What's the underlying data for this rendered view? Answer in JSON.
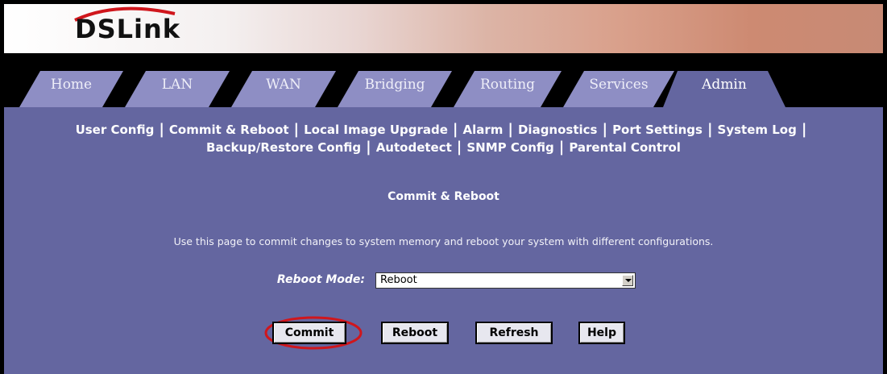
{
  "brand": {
    "logo_text": "DSLink"
  },
  "tabs": [
    {
      "label": "Home",
      "active": false
    },
    {
      "label": "LAN",
      "active": false
    },
    {
      "label": "WAN",
      "active": false
    },
    {
      "label": "Bridging",
      "active": false
    },
    {
      "label": "Routing",
      "active": false
    },
    {
      "label": "Services",
      "active": false
    },
    {
      "label": "Admin",
      "active": true
    }
  ],
  "submenu": {
    "row1": [
      "User Config",
      "Commit & Reboot",
      "Local Image Upgrade",
      "Alarm",
      "Diagnostics",
      "Port Settings",
      "System Log"
    ],
    "row2": [
      "Backup/Restore Config",
      "Autodetect",
      "SNMP Config",
      "Parental Control"
    ],
    "separator": "|"
  },
  "page": {
    "title": "Commit & Reboot",
    "description": "Use this page to commit changes to system memory and reboot your system with different configurations.",
    "reboot_mode_label": "Reboot Mode:",
    "reboot_mode_value": "Reboot"
  },
  "buttons": {
    "commit": "Commit",
    "reboot": "Reboot",
    "refresh": "Refresh",
    "help": "Help"
  },
  "colors": {
    "page_bg": "#6466a0",
    "tab_inactive": "#8e8ec4",
    "tab_active": "#6466a0",
    "highlight_circle": "#d0161c"
  }
}
